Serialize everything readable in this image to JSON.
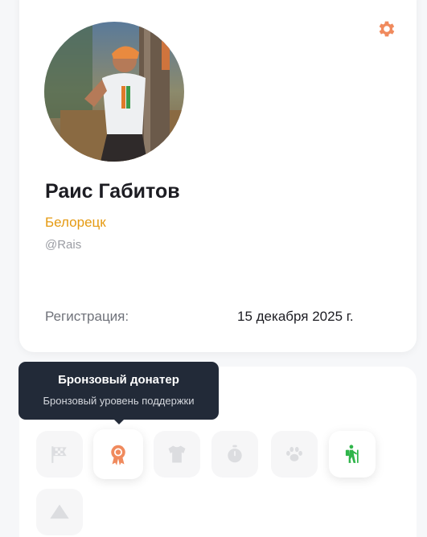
{
  "profile": {
    "name": "Раис Габитов",
    "city": "Белорецк",
    "username": "@Rais",
    "registration_label": "Регистрация:",
    "registration_date": "15 декабря 2025 г."
  },
  "header": {
    "settings_icon": "gear-icon"
  },
  "colors": {
    "accent_orange": "#f08a5d",
    "city": "#e59a12",
    "badge_green": "#2fb54a",
    "tooltip_bg": "#222a38"
  },
  "badges": [
    {
      "icon": "checkered-flag-icon",
      "earned": false
    },
    {
      "icon": "medal-icon",
      "earned": true
    },
    {
      "icon": "tshirt-icon",
      "earned": false
    },
    {
      "icon": "stopwatch-icon",
      "earned": false
    },
    {
      "icon": "paw-icon",
      "earned": false
    },
    {
      "icon": "hiker-icon",
      "earned": true
    },
    {
      "icon": "mountain-icon",
      "earned": false
    }
  ],
  "tooltip": {
    "title": "Бронзовый донатер",
    "description": "Бронзовый уровень поддержки"
  }
}
